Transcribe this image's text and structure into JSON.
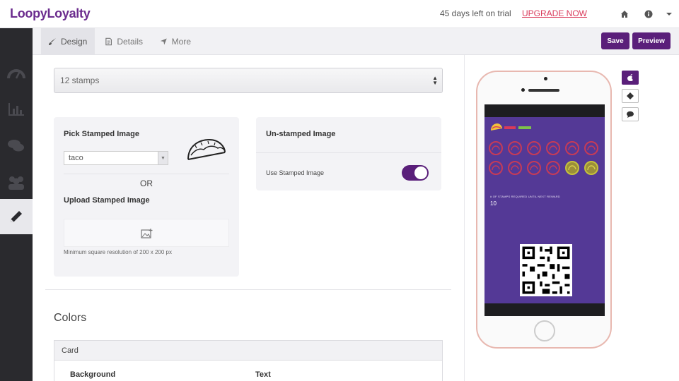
{
  "app": {
    "logo": "LoopyLoyalty",
    "trial_text": "45 days left on trial",
    "upgrade_label": "UPGRADE NOW"
  },
  "topbar_icons": [
    "home-icon",
    "info-icon",
    "chevron-down-icon"
  ],
  "sidebar": {
    "items": [
      "dashboard-icon",
      "analytics-icon",
      "messages-icon",
      "customers-icon",
      "edit-icon"
    ],
    "active_index": 4
  },
  "tabs": [
    {
      "label": "Design",
      "icon": "brush-icon",
      "active": true
    },
    {
      "label": "Details",
      "icon": "document-icon",
      "active": false
    },
    {
      "label": "More",
      "icon": "arrow-icon",
      "active": false
    }
  ],
  "toolbar": {
    "save_label": "Save",
    "preview_label": "Preview"
  },
  "stamps_select": {
    "value": "12 stamps"
  },
  "stamped_card": {
    "title": "Pick Stamped Image",
    "selected": "taco",
    "or_label": "OR",
    "upload_title": "Upload Stamped Image",
    "min_resolution": "Minimum square resolution of 200 x 200 px"
  },
  "unstamped_card": {
    "title": "Un-stamped Image",
    "toggle_label": "Use Stamped Image",
    "toggle_on": true
  },
  "colors": {
    "title": "Colors",
    "table_header": "Card",
    "columns": [
      "Background",
      "Text"
    ]
  },
  "preview_card": {
    "caption": "# OF STAMPS REQUIRED UNTIL NEXT REWARD",
    "count": "10",
    "total_stamps": 12,
    "stamped": 2
  },
  "preview_tools": [
    "apple-icon",
    "android-icon",
    "message-icon"
  ],
  "colors_palette": {
    "brand": "#5a1f7a",
    "card_bg": "#543996",
    "stamp_ring": "#c63b57",
    "upgrade": "#d93a5a"
  }
}
